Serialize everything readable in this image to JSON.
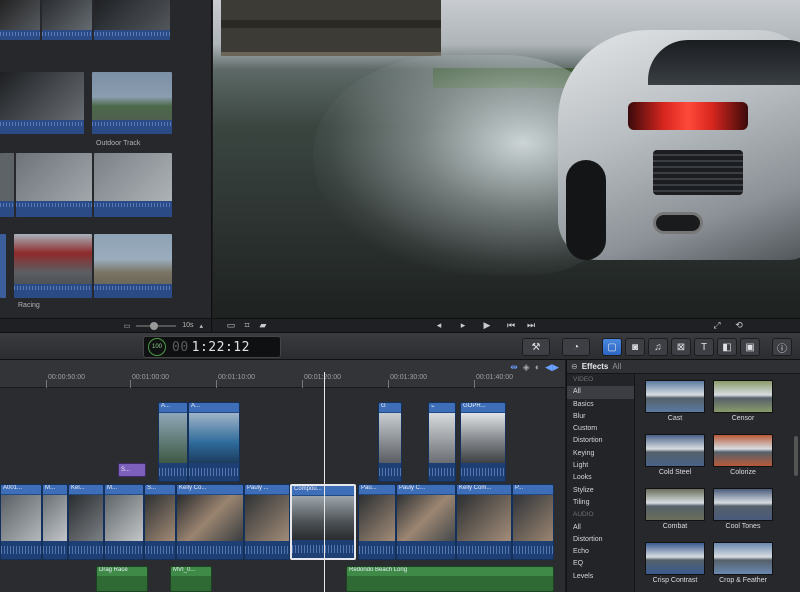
{
  "browser": {
    "clips": [
      {
        "name": ""
      },
      {
        "name": "Outdoor Track"
      },
      {
        "name": ""
      },
      {
        "name": "Racing"
      }
    ],
    "footer": {
      "duration": "10s"
    }
  },
  "toolbar": {
    "timecode_prefix": "00",
    "timecode": "1:22:12"
  },
  "timeline": {
    "ruler": [
      "00:00:50:00",
      "00:01:00:00",
      "00:01:10:00",
      "00:01:20:00",
      "00:01:30:00",
      "00:01:40:00"
    ],
    "connected_clips": [
      "A...",
      "A...",
      "G",
      "GOPR..."
    ],
    "title_clip": "S...",
    "primary_clips": [
      "A001...",
      "M...",
      "Kel...",
      "M...",
      "S...",
      "Kelly Co...",
      "Pauly ...",
      "Compou...",
      "Pau...",
      "Pauly C...",
      "Kelly Com...",
      "P..."
    ],
    "audio_clips": [
      "Drag Race",
      "MVI_0...",
      "Redondo Beach Long"
    ]
  },
  "effects": {
    "title": "Effects",
    "filter": "All",
    "categories": [
      {
        "label": "VIDEO",
        "header": true
      },
      {
        "label": "All",
        "selected": true
      },
      {
        "label": "Basics"
      },
      {
        "label": "Blur"
      },
      {
        "label": "Custom"
      },
      {
        "label": "Distortion"
      },
      {
        "label": "Keying"
      },
      {
        "label": "Light"
      },
      {
        "label": "Looks"
      },
      {
        "label": "Stylize"
      },
      {
        "label": "Tiling"
      },
      {
        "label": "AUDIO",
        "header": true
      },
      {
        "label": "All"
      },
      {
        "label": "Distortion"
      },
      {
        "label": "Echo"
      },
      {
        "label": "EQ"
      },
      {
        "label": "Levels"
      }
    ],
    "tiles": [
      {
        "label": "Cast",
        "color": "#5a7aa0"
      },
      {
        "label": "Censor",
        "color": "#8a9a6a"
      },
      {
        "label": "Cold Steel",
        "color": "#4a6288"
      },
      {
        "label": "Colorize",
        "color": "#b85a3a"
      },
      {
        "label": "Combat",
        "color": "#6a6e5a"
      },
      {
        "label": "Cool Tones",
        "color": "#4a5a7a"
      },
      {
        "label": "Crisp Contrast",
        "color": "#3a5a90"
      },
      {
        "label": "Crop & Feather",
        "color": "#6a88b0"
      }
    ]
  }
}
